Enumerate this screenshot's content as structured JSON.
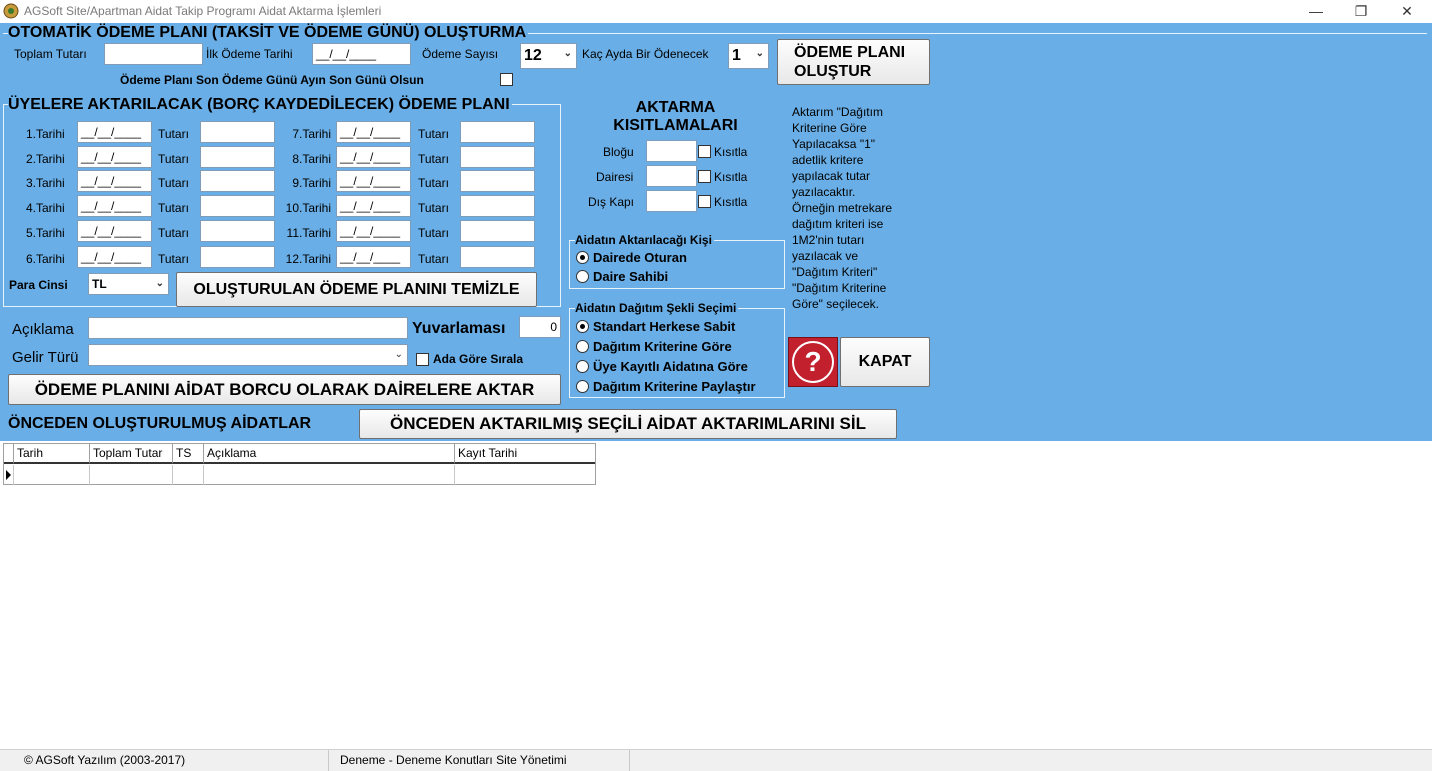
{
  "window": {
    "title": "AGSoft Site/Apartman Aidat Takip Programı Aidat Aktarma İşlemleri",
    "minimize": "—",
    "restore": "❐",
    "close": "✕"
  },
  "auto_plan": {
    "header": "OTOMATİK ÖDEME PLANI (TAKSİT VE ÖDEME GÜNÜ) OLUŞTURMA",
    "toplam_tutari_label": "Toplam Tutarı",
    "toplam_tutari_value": "",
    "ilk_odeme_tarihi_label": "İlk Ödeme Tarihi",
    "ilk_odeme_tarihi_value": "__/__/____",
    "odeme_sayisi_label": "Ödeme Sayısı",
    "odeme_sayisi_value": "12",
    "kac_ayda_label": "Kaç Ayda Bir Ödenecek",
    "kac_ayda_value": "1",
    "son_gun_label": "Ödeme Planı Son Ödeme Günü Ayın Son Günü Olsun",
    "olustur_button_line1": "ÖDEME PLANI",
    "olustur_button_line2": "OLUŞTUR"
  },
  "plan": {
    "header": "ÜYELERE AKTARILACAK (BORÇ KAYDEDİLECEK) ÖDEME PLANI",
    "tutari_label": "Tutarı",
    "date_placeholder": "__/__/____",
    "left_rows": [
      {
        "label": "1.Tarihi"
      },
      {
        "label": "2.Tarihi"
      },
      {
        "label": "3.Tarihi"
      },
      {
        "label": "4.Tarihi"
      },
      {
        "label": "5.Tarihi"
      },
      {
        "label": "6.Tarihi"
      }
    ],
    "right_rows": [
      {
        "label": "7.Tarihi"
      },
      {
        "label": "8.Tarihi"
      },
      {
        "label": "9.Tarihi"
      },
      {
        "label": "10.Tarihi"
      },
      {
        "label": "11.Tarihi"
      },
      {
        "label": "12.Tarihi"
      }
    ],
    "para_cinsi_label": "Para Cinsi",
    "para_cinsi_value": "TL",
    "temizle_button": "OLUŞTURULAN ÖDEME PLANINI TEMİZLE"
  },
  "restrictions": {
    "header_line1": "AKTARMA",
    "header_line2": "KISITLAMALARI",
    "blogu_label": "Bloğu",
    "dairesi_label": "Dairesi",
    "dis_kapi_label": "Dış Kapı",
    "kisitla_label": "Kısıtla"
  },
  "note": {
    "lines": [
      "Aktarım \"Dağıtım",
      "Kriterine Göre",
      "Yapılacaksa \"1\"",
      "adetlik kritere",
      "yapılacak tutar",
      "yazılacaktır.",
      "Örneğin metrekare",
      "dağıtım kriteri ise",
      "1M2'nin tutarı",
      "yazılacak ve",
      "\"Dağıtım Kriteri\"",
      "\"Dağıtım Kriterine",
      "Göre\" seçilecek."
    ]
  },
  "person": {
    "title": "Aidatın Aktarılacağı Kişi",
    "options": [
      {
        "label": "Dairede Oturan",
        "selected": true
      },
      {
        "label": "Daire Sahibi",
        "selected": false
      }
    ]
  },
  "distribution": {
    "title": "Aidatın Dağıtım Şekli Seçimi",
    "options": [
      {
        "label": "Standart Herkese Sabit",
        "selected": true
      },
      {
        "label": "Dağıtım Kriterine Göre",
        "selected": false
      },
      {
        "label": "Üye Kayıtlı Aidatına Göre",
        "selected": false
      },
      {
        "label": "Dağıtım Kriterine Paylaştır",
        "selected": false
      }
    ]
  },
  "footer_form": {
    "aciklama_label": "Açıklama",
    "aciklama_value": "",
    "yuvarlamasi_label": "Yuvarlaması",
    "yuvarlamasi_value": "0",
    "gelir_turu_label": "Gelir Türü",
    "gelir_turu_value": "",
    "ada_gore_label": "Ada Göre Sırala",
    "aktar_button": "ÖDEME PLANINI AİDAT BORCU  OLARAK DAİRELERE AKTAR",
    "help_icon_text": "?",
    "kapat_button": "KAPAT"
  },
  "history": {
    "title": "ÖNCEDEN OLUŞTURULMUŞ AİDATLAR",
    "sil_button": "ÖNCEDEN AKTARILMIŞ SEÇİLİ AİDAT AKTARIMLARINI SİL",
    "columns": [
      "Tarih",
      "Toplam Tutar",
      "TS",
      "Açıklama",
      "Kayıt Tarihi"
    ]
  },
  "status": {
    "copyright": "© AGSoft Yazılım (2003-2017)",
    "site": "Deneme - Deneme Konutları Site Yönetimi"
  },
  "colors": {
    "panel": "#69aee6",
    "help_bg": "#c3202e"
  }
}
